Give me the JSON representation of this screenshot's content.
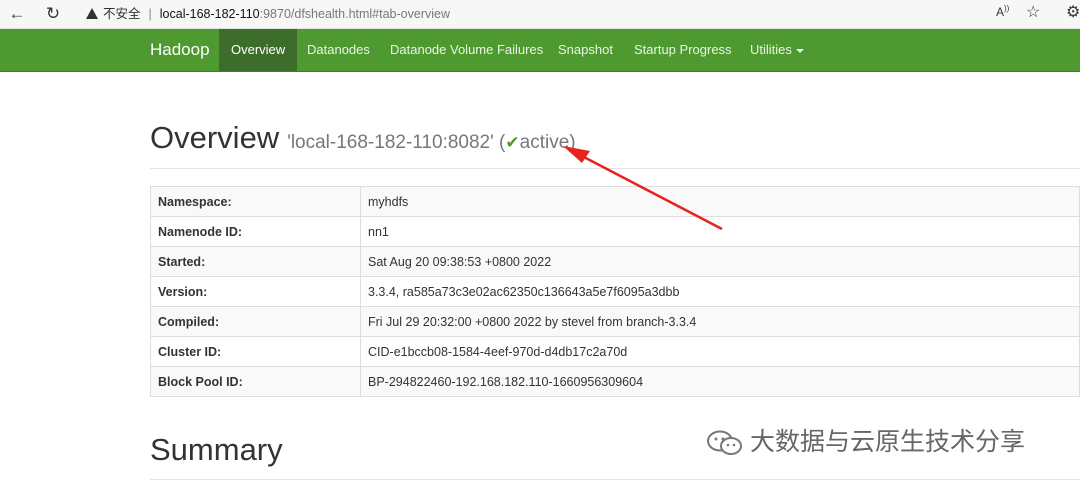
{
  "browser": {
    "insecure_label": "不安全",
    "url_host": "local-168-182-110",
    "url_rest": ":9870/dfshealth.html#tab-overview",
    "read_aloud_label": "A⁵"
  },
  "navbar": {
    "brand": "Hadoop",
    "items": [
      {
        "label": "Overview"
      },
      {
        "label": "Datanodes"
      },
      {
        "label": "Datanode Volume Failures"
      },
      {
        "label": "Snapshot"
      },
      {
        "label": "Startup Progress"
      },
      {
        "label": "Utilities"
      }
    ],
    "accent_color": "#4e9a31"
  },
  "overview": {
    "title": "Overview",
    "node": "'local-168-182-110:8082'",
    "status_open": "(",
    "status": "active",
    "status_close": ")"
  },
  "info_rows": [
    {
      "key": "Namespace:",
      "value": "myhdfs"
    },
    {
      "key": "Namenode ID:",
      "value": "nn1"
    },
    {
      "key": "Started:",
      "value": "Sat Aug 20 09:38:53 +0800 2022"
    },
    {
      "key": "Version:",
      "value": "3.3.4, ra585a73c3e02ac62350c136643a5e7f6095a3dbb"
    },
    {
      "key": "Compiled:",
      "value": "Fri Jul 29 20:32:00 +0800 2022 by stevel from branch-3.3.4"
    },
    {
      "key": "Cluster ID:",
      "value": "CID-e1bccb08-1584-4eef-970d-d4db17c2a70d"
    },
    {
      "key": "Block Pool ID:",
      "value": "BP-294822460-192.168.182.110-1660956309604"
    }
  ],
  "summary": {
    "title": "Summary"
  },
  "watermark": {
    "text": "大数据与云原生技术分享"
  }
}
